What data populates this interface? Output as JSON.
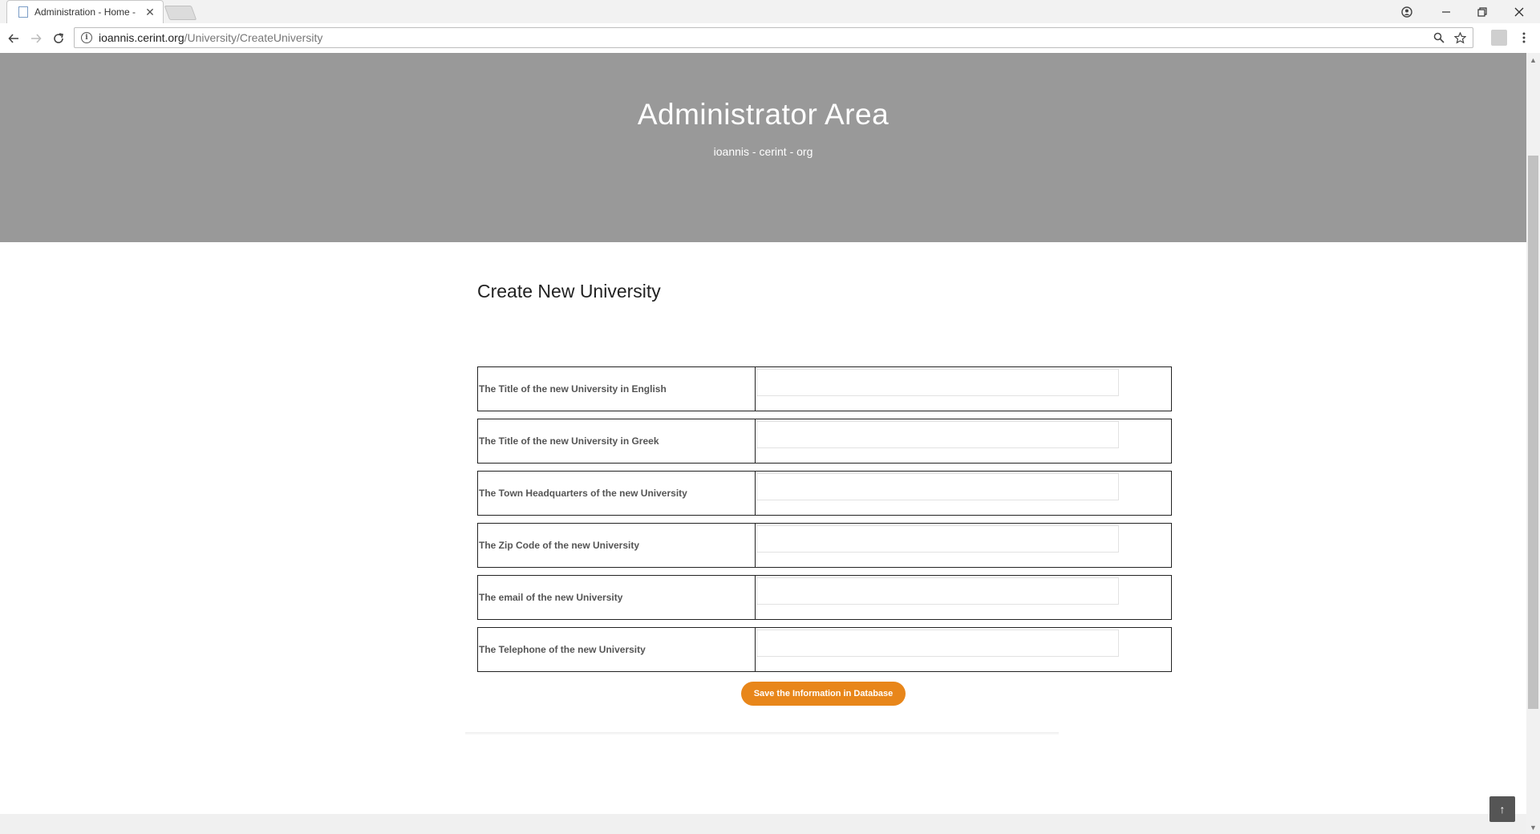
{
  "browser": {
    "tab_title": "Administration - Home -",
    "tab_close": "✕",
    "url_host": "ioannis.cerint.org",
    "url_path": "/University/CreateUniversity",
    "icons": {
      "back": "back-arrow-icon",
      "forward": "forward-arrow-icon",
      "reload": "reload-icon",
      "info": "info-icon",
      "zoom": "magnifier-icon",
      "bookmark": "star-icon",
      "account": "account-icon",
      "minimize": "minimize-icon",
      "restore": "restore-icon",
      "close": "close-icon",
      "menu": "kebab-menu-icon"
    }
  },
  "hero": {
    "title": "Administrator Area",
    "subtitle": "ioannis - cerint - org",
    "background": "#999999"
  },
  "form": {
    "title": "Create New University",
    "fields": [
      {
        "label": "The Title of the new University in English",
        "value": "",
        "placeholder": ""
      },
      {
        "label": "The Title of the new University in Greek",
        "value": "",
        "placeholder": ""
      },
      {
        "label": "The Town Headquarters of the new University",
        "value": "",
        "placeholder": ""
      },
      {
        "label": "The Zip Code of the new University",
        "value": "",
        "placeholder": ""
      },
      {
        "label": "The email of the new University",
        "value": "",
        "placeholder": ""
      },
      {
        "label": "The Telephone of the new University",
        "value": "",
        "placeholder": ""
      }
    ],
    "submit_label": "Save the Information in Database",
    "submit_color": "#e8861a"
  },
  "back_to_top": "↑"
}
